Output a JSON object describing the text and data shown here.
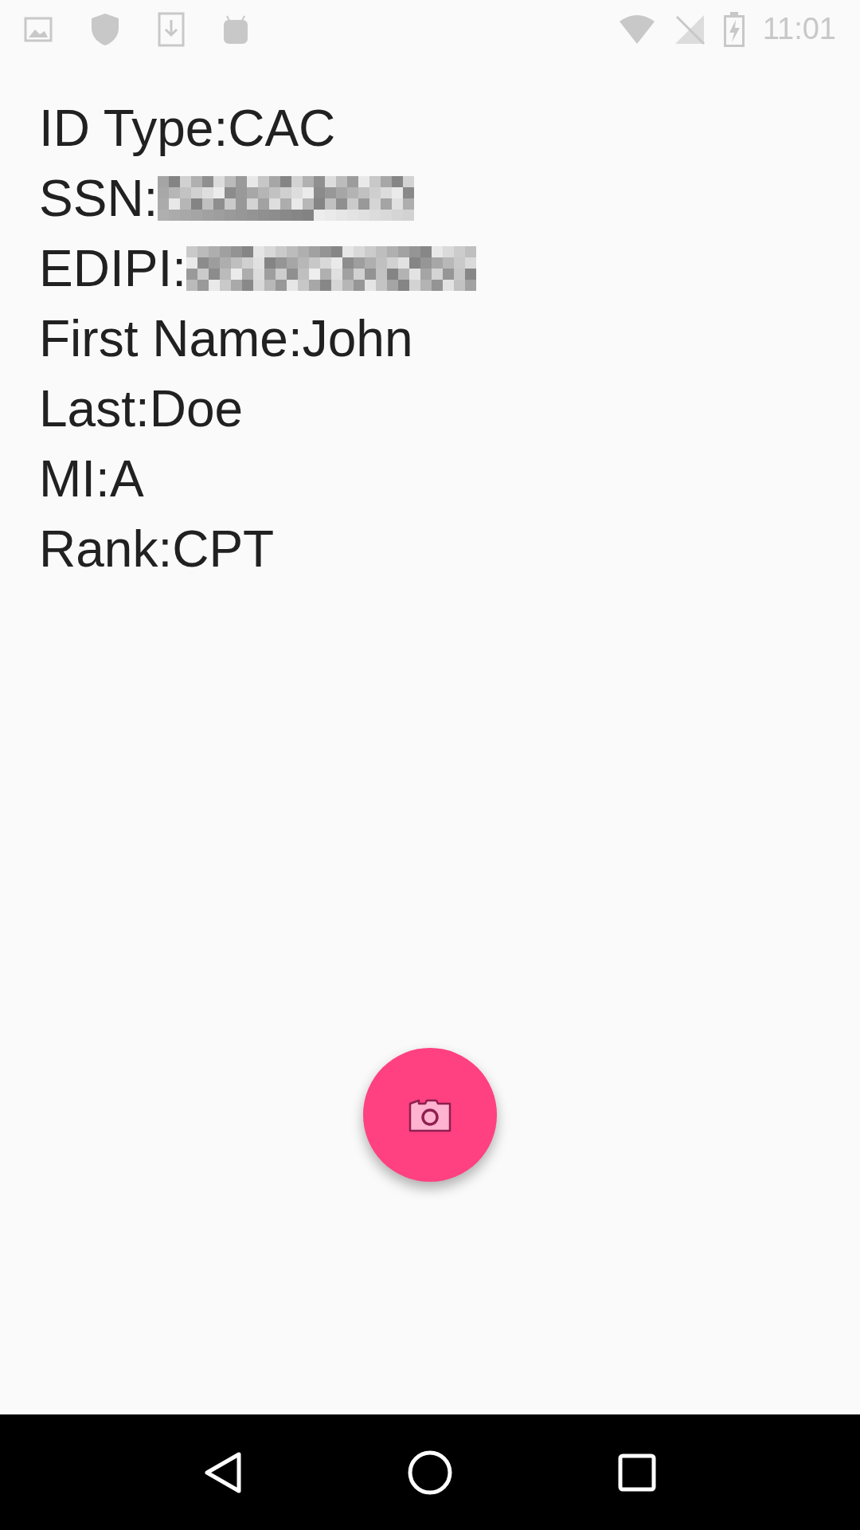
{
  "status_bar": {
    "time": "11:01"
  },
  "fields": [
    {
      "text": "ID Type:CAC",
      "redacted": false
    },
    {
      "text": "SSN:",
      "redacted": true
    },
    {
      "text": "EDIPI:",
      "redacted": true
    },
    {
      "text": "First Name:John",
      "redacted": false
    },
    {
      "text": "Last:Doe",
      "redacted": false
    },
    {
      "text": "MI:A",
      "redacted": false
    },
    {
      "text": "Rank:CPT",
      "redacted": false
    }
  ]
}
